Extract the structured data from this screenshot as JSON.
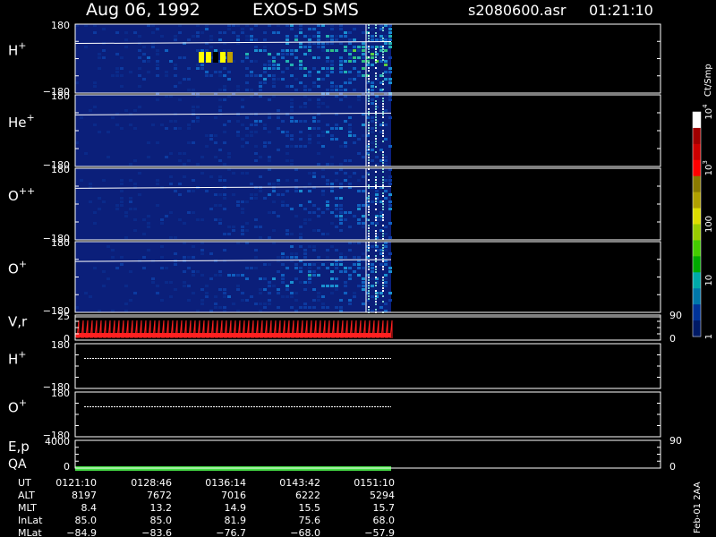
{
  "header": {
    "date": "Aug 06, 1992",
    "instrument": "EXOS-D SMS",
    "filename": "s2080600.asr",
    "time": "01:21:10"
  },
  "chart_data": {
    "type": "heatmap",
    "panels": [
      {
        "id": "h",
        "label": "H",
        "superscript": "+",
        "ymax": "180",
        "ymin": "−180",
        "kind": "spectrogram",
        "intensity": 1.0
      },
      {
        "id": "he",
        "label": "He",
        "superscript": "+",
        "ymax": "180",
        "ymin": "−180",
        "kind": "spectrogram",
        "intensity": 0.55
      },
      {
        "id": "opp",
        "label": "O",
        "superscript": "++",
        "ymax": "180",
        "ymin": "−180",
        "kind": "spectrogram",
        "intensity": 0.6
      },
      {
        "id": "op",
        "label": "O",
        "superscript": "+",
        "ymax": "180",
        "ymin": "−180",
        "kind": "spectrogram",
        "intensity": 0.7
      },
      {
        "id": "vr",
        "label": "V,r",
        "superscript": "",
        "ymax": "25",
        "ymin": "0",
        "right_top": "90",
        "right_bottom": "0",
        "kind": "sawtooth"
      },
      {
        "id": "h2",
        "label": "H",
        "superscript": "+",
        "ymax": "180",
        "ymin": "−180",
        "kind": "line"
      },
      {
        "id": "o2",
        "label": "O",
        "superscript": "+",
        "ymax": "180",
        "ymin": "−180",
        "kind": "line"
      },
      {
        "id": "ep",
        "label": "E,p",
        "label2": "QA",
        "ymax": "4000",
        "ymin": "0",
        "right_top": "90",
        "right_bottom": "0",
        "kind": "qa"
      }
    ],
    "colorbar": {
      "unit": "Ct/Smp",
      "labels": [
        {
          "text": "10",
          "exp": "4",
          "value": 10000
        },
        {
          "text": "10",
          "exp": "3",
          "value": 1000
        },
        {
          "text": "100",
          "exp": "",
          "value": 100
        },
        {
          "text": "10",
          "exp": "",
          "value": 10
        },
        {
          "text": "1",
          "exp": "",
          "value": 1
        }
      ],
      "colors": [
        "#ffffff",
        "#a00000",
        "#cc0000",
        "#ff0000",
        "#8a7a00",
        "#b0a000",
        "#dddd00",
        "#99cc00",
        "#44cc00",
        "#00aa00",
        "#00aaaa",
        "#0077aa",
        "#003399",
        "#001a66"
      ]
    },
    "x_axis": {
      "rows": [
        {
          "label": "UT",
          "values": [
            "0121:10",
            "0128:46",
            "0136:14",
            "0143:42",
            "0151:10"
          ]
        },
        {
          "label": "ALT",
          "values": [
            "8197",
            "7672",
            "7016",
            "6222",
            "5294"
          ]
        },
        {
          "label": "MLT",
          "values": [
            "8.4",
            "13.2",
            "14.9",
            "15.5",
            "15.7"
          ]
        },
        {
          "label": "InLat",
          "values": [
            "85.0",
            "85.0",
            "81.9",
            "75.6",
            "68.0"
          ]
        },
        {
          "label": "MLat",
          "values": [
            "−84.9",
            "−83.6",
            "−76.7",
            "−68.0",
            "−57.9"
          ]
        }
      ]
    },
    "footer": "Feb-01 2AA"
  }
}
